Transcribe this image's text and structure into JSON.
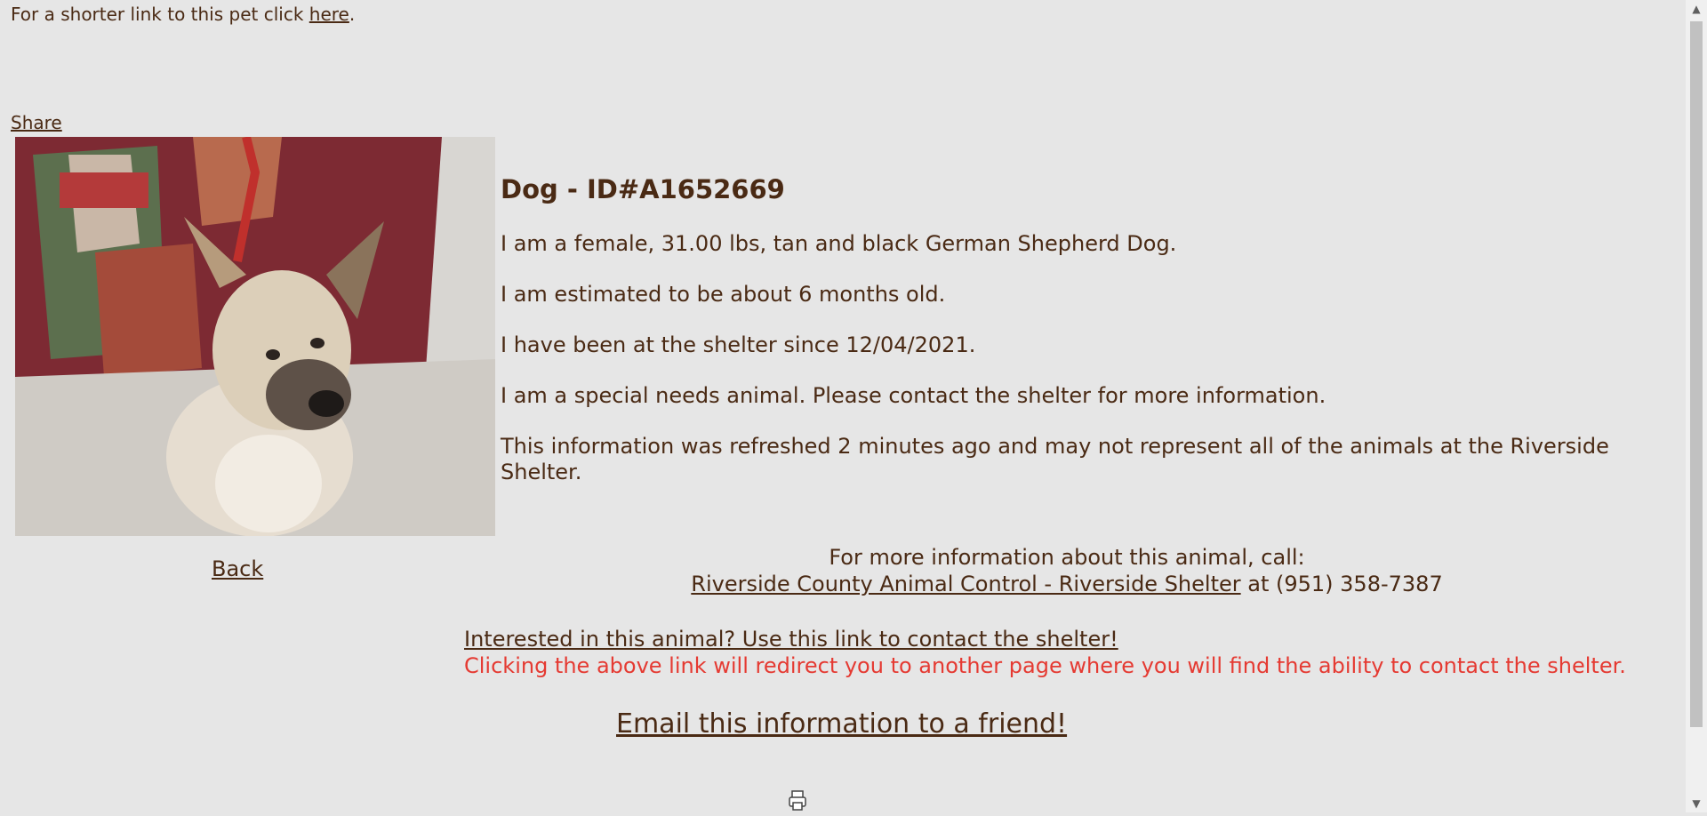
{
  "shortlink": {
    "prefix": "For a shorter link to this pet click ",
    "link": "here",
    "suffix": "."
  },
  "share": "Share",
  "photo": {
    "alt": "German Shepherd puppy sitting on a carpet"
  },
  "details": {
    "title": "Dog - ID#A1652669",
    "lines": [
      "I am a female, 31.00 lbs, tan and black German Shepherd Dog.",
      "I am estimated to be about 6 months old.",
      "I have been at the shelter since 12/04/2021.",
      "I am a special needs animal. Please contact the shelter for more information.",
      "This information was refreshed 2 minutes ago and may not represent all of the animals at the Riverside Shelter."
    ]
  },
  "back": "Back",
  "call": {
    "heading": "For more information about this animal, call:",
    "shelter_link": "Riverside County Animal Control - Riverside Shelter",
    "phone": " at (951) 358-7387"
  },
  "interest": {
    "link": "Interested in this animal? Use this link to contact the shelter!",
    "warning": "Clicking the above link will redirect you to another page where you will find the ability to contact the shelter."
  },
  "email": "Email this information to a friend!",
  "icons": {
    "scroll_up": "scroll-up-arrow-icon",
    "scroll_down": "scroll-down-arrow-icon",
    "print": "printer-icon"
  },
  "colors": {
    "background": "#e6e6e6",
    "text": "#4a2a14",
    "warning": "#e53a32"
  }
}
